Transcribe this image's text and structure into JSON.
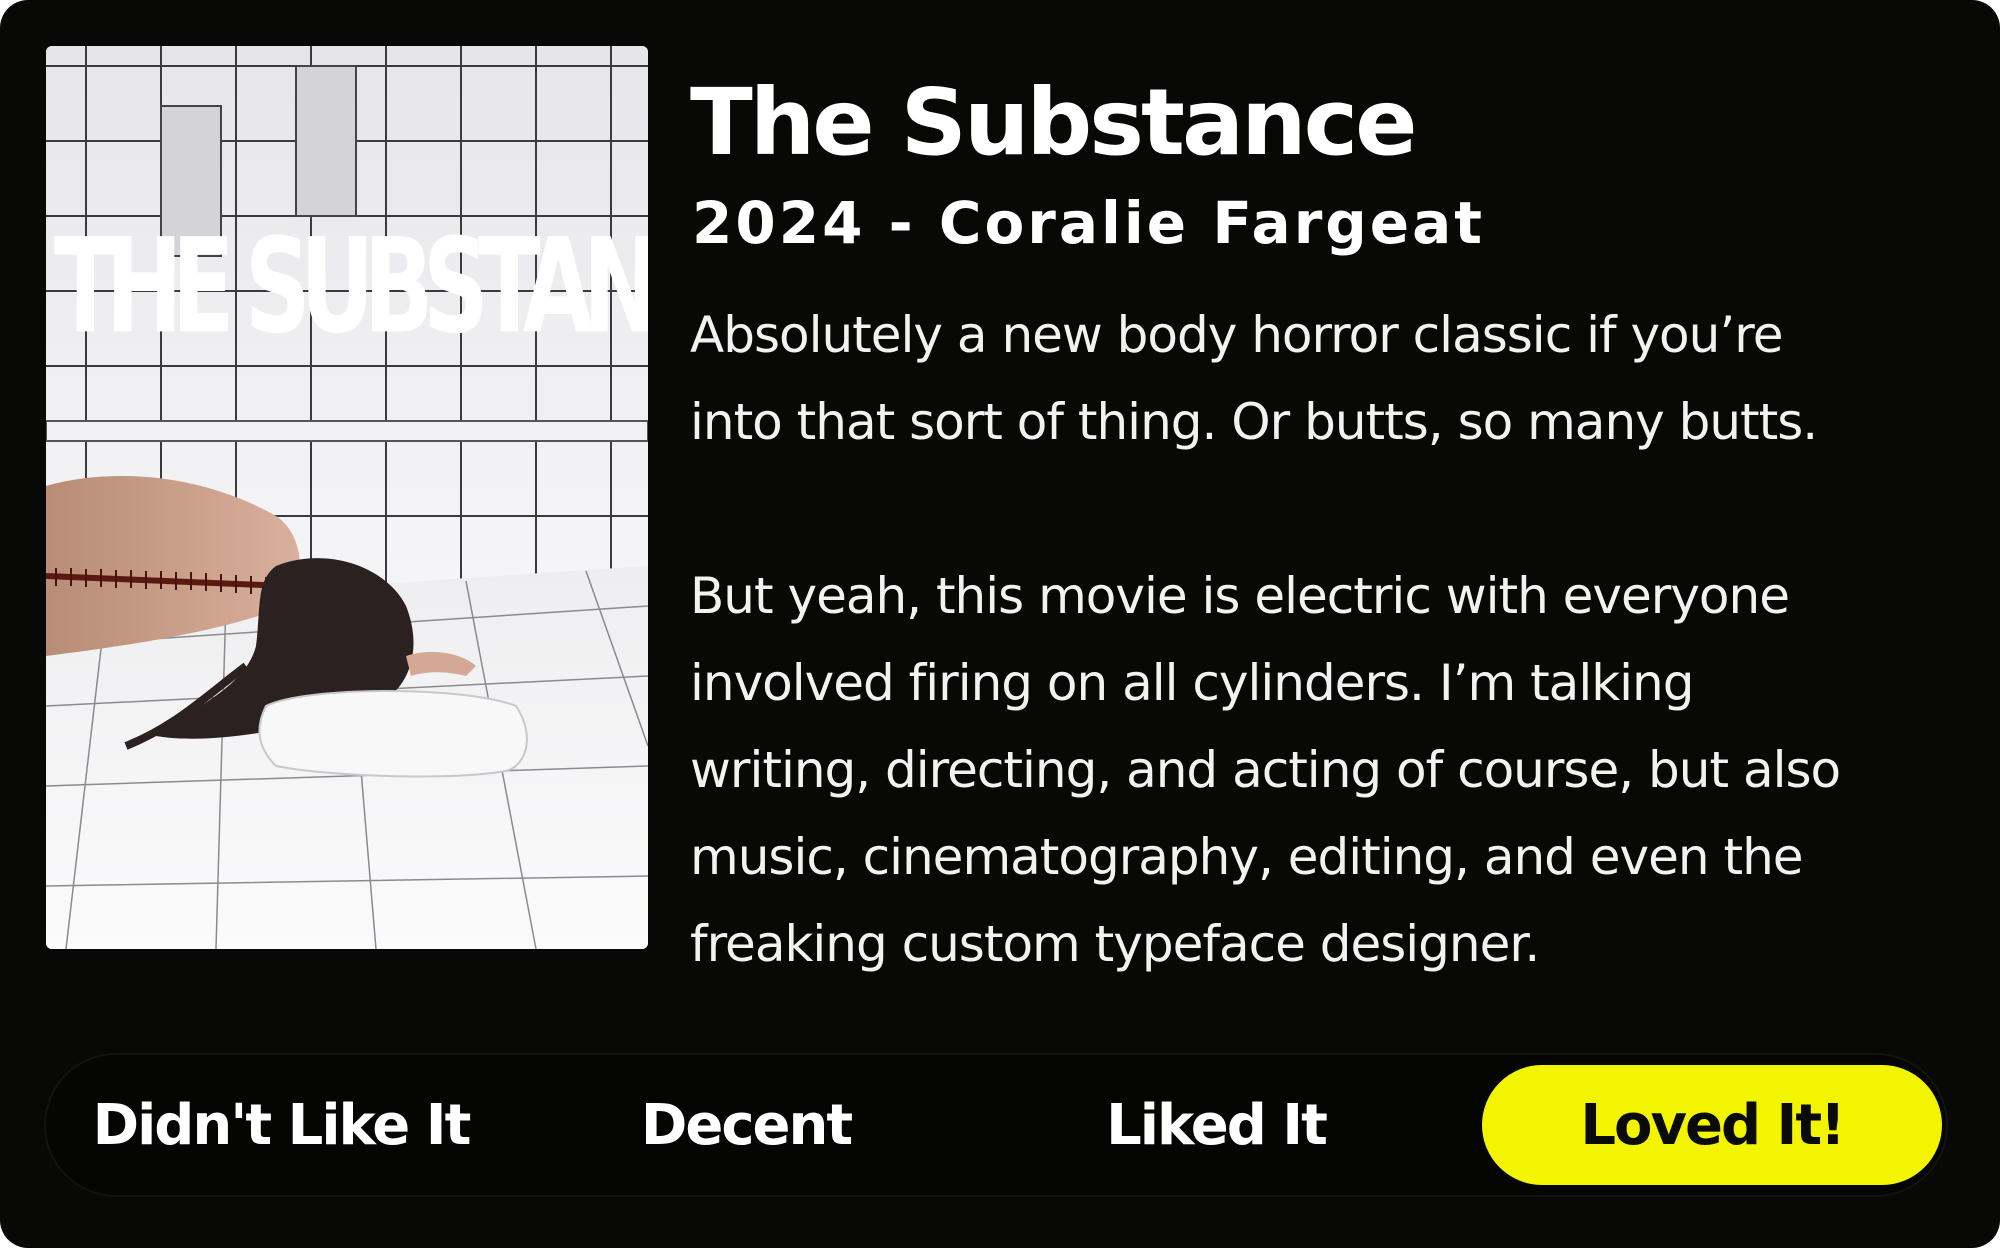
{
  "colors": {
    "background": "#080806",
    "text": "#ffffff",
    "selected_rating_bg": "#f3f400",
    "selected_rating_text": "#0a0a0a"
  },
  "poster": {
    "title_text": "THE SUBSTANCE"
  },
  "movie": {
    "title": "The Substance",
    "meta": "2024 - Coralie Fargeat"
  },
  "review": {
    "lines": [
      "Absolutely a new body horror classic if you’re",
      "into that sort of thing. Or butts, so many butts.",
      "",
      "But yeah, this movie is electric with everyone",
      "involved firing on all cylinders. I’m talking",
      "writing, directing, and acting of course, but also",
      "music, cinematography, editing, and even the",
      "freaking custom typeface designer."
    ]
  },
  "rating": {
    "options": [
      {
        "label": "Didn't Like It"
      },
      {
        "label": "Decent"
      },
      {
        "label": "Liked It"
      },
      {
        "label": "Loved It!"
      }
    ],
    "selected": "Loved It!"
  }
}
